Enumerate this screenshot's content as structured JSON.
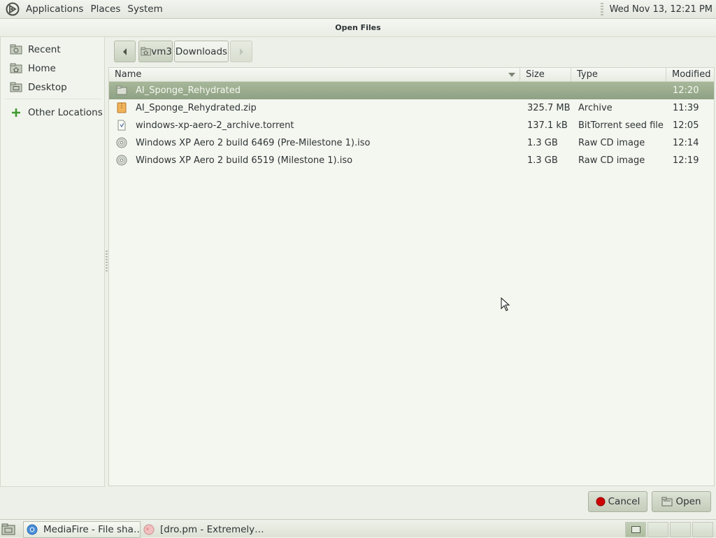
{
  "top_panel": {
    "menus": [
      "Applications",
      "Places",
      "System"
    ],
    "clock": "Wed Nov 13, 12:21 PM"
  },
  "dialog": {
    "title": "Open Files"
  },
  "sidebar": {
    "items": [
      {
        "label": "Recent",
        "icon": "recent-icon"
      },
      {
        "label": "Home",
        "icon": "home-icon"
      },
      {
        "label": "Desktop",
        "icon": "desktop-icon"
      },
      {
        "label": "Other Locations",
        "icon": "plus-icon"
      }
    ]
  },
  "path_bar": {
    "segments": [
      "vm3",
      "Downloads"
    ]
  },
  "file_list": {
    "columns": [
      "Name",
      "Size",
      "Type",
      "Modified"
    ],
    "rows": [
      {
        "name": "AI_Sponge_Rehydrated",
        "size": "",
        "type": "",
        "modified": "12:20",
        "icon": "folder-icon",
        "selected": true
      },
      {
        "name": "AI_Sponge_Rehydrated.zip",
        "size": "325.7 MB",
        "type": "Archive",
        "modified": "11:39",
        "icon": "archive-icon",
        "selected": false
      },
      {
        "name": "windows-xp-aero-2_archive.torrent",
        "size": "137.1 kB",
        "type": "BitTorrent seed file",
        "modified": "12:05",
        "icon": "torrent-file-icon",
        "selected": false
      },
      {
        "name": "Windows XP Aero 2 build 6469 (Pre-Milestone 1).iso",
        "size": "1.3 GB",
        "type": "Raw CD image",
        "modified": "12:14",
        "icon": "disc-image-icon",
        "selected": false
      },
      {
        "name": "Windows XP Aero 2 build 6519 (Milestone 1).iso",
        "size": "1.3 GB",
        "type": "Raw CD image",
        "modified": "12:19",
        "icon": "disc-image-icon",
        "selected": false
      }
    ]
  },
  "buttons": {
    "cancel": "Cancel",
    "open": "Open"
  },
  "taskbar": {
    "tasks": [
      {
        "label": "MediaFire - File sha…",
        "icon": "chromium-icon",
        "active": true
      },
      {
        "label": "[dro.pm - Extremely…",
        "icon": "app-icon",
        "active": false
      }
    ]
  },
  "colors": {
    "selection": "#98a98b",
    "panel": "#e9ece4",
    "accent_red": "#cc0000"
  }
}
